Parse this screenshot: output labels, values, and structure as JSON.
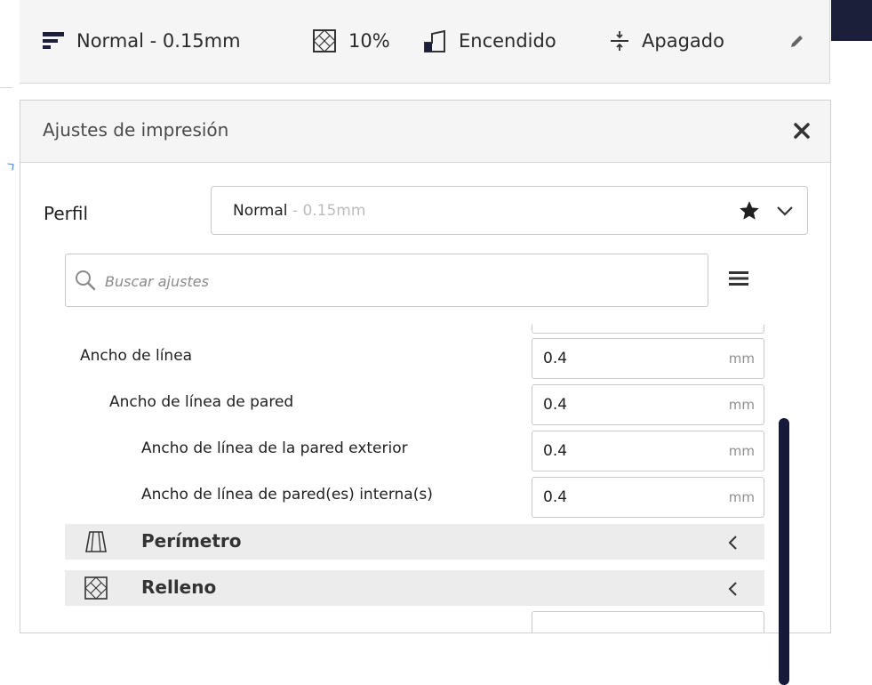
{
  "toolbar": {
    "profile": "Normal - 0.15mm",
    "infill": "10%",
    "support": "Encendido",
    "adhesion": "Apagado"
  },
  "panel": {
    "title": "Ajustes de impresión",
    "profile_label": "Perfil",
    "profile_name": "Normal",
    "profile_layer": " - 0.15mm",
    "search_placeholder": "Buscar ajustes"
  },
  "settings": [
    {
      "label": "Ancho de línea",
      "value": "0.4",
      "unit": "mm",
      "indent": 0
    },
    {
      "label": "Ancho de línea de pared",
      "value": "0.4",
      "unit": "mm",
      "indent": 1
    },
    {
      "label": "Ancho de línea de la pared exterior",
      "value": "0.4",
      "unit": "mm",
      "indent": 2
    },
    {
      "label": "Ancho de línea de pared(es) interna(s)",
      "value": "0.4",
      "unit": "mm",
      "indent": 2
    }
  ],
  "categories": [
    {
      "label": "Perímetro",
      "icon": "perimeter-icon"
    },
    {
      "label": "Relleno",
      "icon": "infill-icon"
    }
  ],
  "colors": {
    "toolbar_bg": "#f5f5f5",
    "scrollbar": "#16193a",
    "category_bg": "#ececec",
    "muted_text": "#bcbcbc"
  }
}
